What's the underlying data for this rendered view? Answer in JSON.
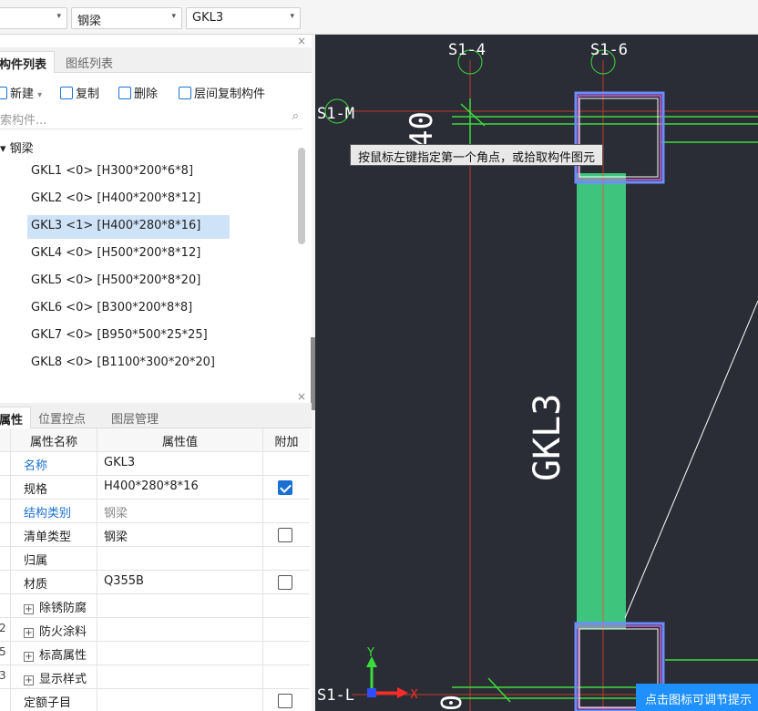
{
  "toolbar": {
    "combo_blank_value": "",
    "combo_type_value": "钢梁",
    "combo_member_value": "GKL3",
    "arrow": "▾"
  },
  "component_panel": {
    "close": "×",
    "tabs": [
      "构件列表",
      "图纸列表"
    ],
    "actions": {
      "new": "新建",
      "new_arrow": "▾",
      "copy": "复制",
      "delete": "删除",
      "floor_copy": "层间复制构件"
    },
    "search_placeholder": "索构件...",
    "tree_root": "▾ 钢梁",
    "items": [
      "GKL1 <0> [H300*200*6*8]",
      "GKL2 <0> [H400*200*8*12]",
      "GKL3 <1> [H400*280*8*16]",
      "GKL4 <0> [H500*200*8*12]",
      "GKL5 <0> [H500*200*8*20]",
      "GKL6 <0> [B300*200*8*8]",
      "GKL7 <0> [B950*500*25*25]",
      "GKL8 <0> [B1100*300*20*20]"
    ],
    "selected_index": 2
  },
  "property_panel": {
    "close": "×",
    "tabs": [
      "属性",
      "位置控点",
      "图层管理"
    ],
    "headers": {
      "name": "属性名称",
      "value": "属性值",
      "extra": "附加"
    },
    "rows": [
      {
        "num": "",
        "name": "名称",
        "value": "GKL3",
        "style": "blue",
        "check": null,
        "expand": false
      },
      {
        "num": "",
        "name": "规格",
        "value": "H400*280*8*16",
        "style": "",
        "check": true,
        "expand": false
      },
      {
        "num": "",
        "name": "结构类别",
        "value": "钢梁",
        "style": "blue-grey",
        "check": null,
        "expand": false
      },
      {
        "num": "",
        "name": "清单类型",
        "value": "钢梁",
        "style": "",
        "check": false,
        "expand": false
      },
      {
        "num": "",
        "name": "归属",
        "value": "",
        "style": "",
        "check": null,
        "expand": false
      },
      {
        "num": "",
        "name": "材质",
        "value": "Q355B",
        "style": "",
        "check": false,
        "expand": false
      },
      {
        "num": "",
        "name": "除锈防腐",
        "value": "",
        "style": "",
        "check": null,
        "expand": true
      },
      {
        "num": "2",
        "name": "防火涂料",
        "value": "",
        "style": "",
        "check": null,
        "expand": true
      },
      {
        "num": "5",
        "name": "标高属性",
        "value": "",
        "style": "",
        "check": null,
        "expand": true
      },
      {
        "num": "3",
        "name": "显示样式",
        "value": "",
        "style": "",
        "check": null,
        "expand": true
      },
      {
        "num": "",
        "name": "定额子目",
        "value": "",
        "style": "",
        "check": false,
        "expand": false
      }
    ]
  },
  "canvas": {
    "axis_labels": [
      "S1-4",
      "S1-6",
      "S1-M",
      "S1-L"
    ],
    "member_label": "GKL3",
    "partial_label_top": "40",
    "partial_label_bottom": "0",
    "tooltip": "按鼠标左键指定第一个角点，或拾取构件图元",
    "hint": "点击图标可调节提示",
    "ucs_x": "X",
    "ucs_y": "Y",
    "colors": {
      "background": "#2a2d35",
      "beam_fill": "#3ec47c",
      "grid_red": "#c0392b",
      "green": "#3ddc3d",
      "cyan": "#5fd3ff",
      "magenta": "#d35fd3",
      "hint_bg": "#1e90ff"
    }
  }
}
